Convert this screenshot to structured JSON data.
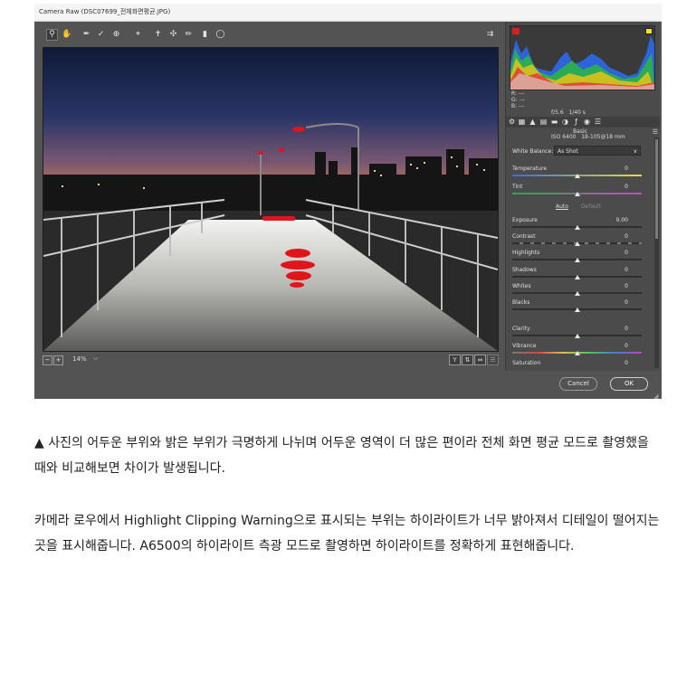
{
  "window": {
    "title": "Camera Raw (DSC07699_전체화면평균.JPG)"
  },
  "toolbar": {
    "tools": [
      "zoom-icon",
      "hand-icon",
      "white-balance-icon",
      "color-sampler-icon",
      "target-adjust-icon",
      "crop-icon",
      "straighten-icon",
      "spot-removal-icon",
      "red-eye-icon",
      "adjustment-brush-icon",
      "graduated-filter-icon",
      "radial-filter-icon",
      "toggle-fullscreen-icon"
    ]
  },
  "histogram": {
    "rgb": [
      "R:  ---",
      "G:  ---",
      "B:  ---"
    ],
    "camera_line1": "f/5.6   1/40 s",
    "camera_line2": "ISO 6400   18-105@18 mm"
  },
  "panel": {
    "section_title": "Basic",
    "white_balance": {
      "label": "White Balance:",
      "value": "As Shot"
    },
    "auto_label": "Auto",
    "default_label": "Default",
    "sliders": [
      {
        "label": "Temperature",
        "value": "0",
        "pos": 0.5
      },
      {
        "label": "Tint",
        "value": "0",
        "pos": 0.5
      },
      {
        "label": "Exposure",
        "value": "0.00",
        "pos": 0.5
      },
      {
        "label": "Contrast",
        "value": "0",
        "pos": 0.5
      },
      {
        "label": "Highlights",
        "value": "0",
        "pos": 0.5
      },
      {
        "label": "Shadows",
        "value": "0",
        "pos": 0.5
      },
      {
        "label": "Whites",
        "value": "0",
        "pos": 0.5
      },
      {
        "label": "Blacks",
        "value": "0",
        "pos": 0.5
      },
      {
        "label": "Clarity",
        "value": "0",
        "pos": 0.5
      },
      {
        "label": "Vibrance",
        "value": "0",
        "pos": 0.5
      },
      {
        "label": "Saturation",
        "value": "0",
        "pos": 0.5
      }
    ]
  },
  "zoom": {
    "value": "14%"
  },
  "buttons": {
    "cancel": "Cancel",
    "ok": "OK"
  },
  "caption": {
    "p1": "▲ 사진의 어두운 부위와 밝은 부위가 극명하게 나뉘며 어두운 영역이 더 많은 편이라 전체 화면 평균 모드로 촬영했을 때와 비교해보면 차이가 발생됩니다.",
    "p2": "카메라 로우에서 Highlight Clipping Warning으로 표시되는 부위는 하이라이트가 너무 밝아져서 디테일이 떨어지는 곳을 표시해줍니다. A6500의 하이라이트 측광 모드로 촬영하면 하이라이트를 정확하게 표현해줍니다."
  },
  "colors": {
    "clip_warning": "#e0151b",
    "panel_bg": "#4b4b4b",
    "window_bg": "#535353"
  }
}
